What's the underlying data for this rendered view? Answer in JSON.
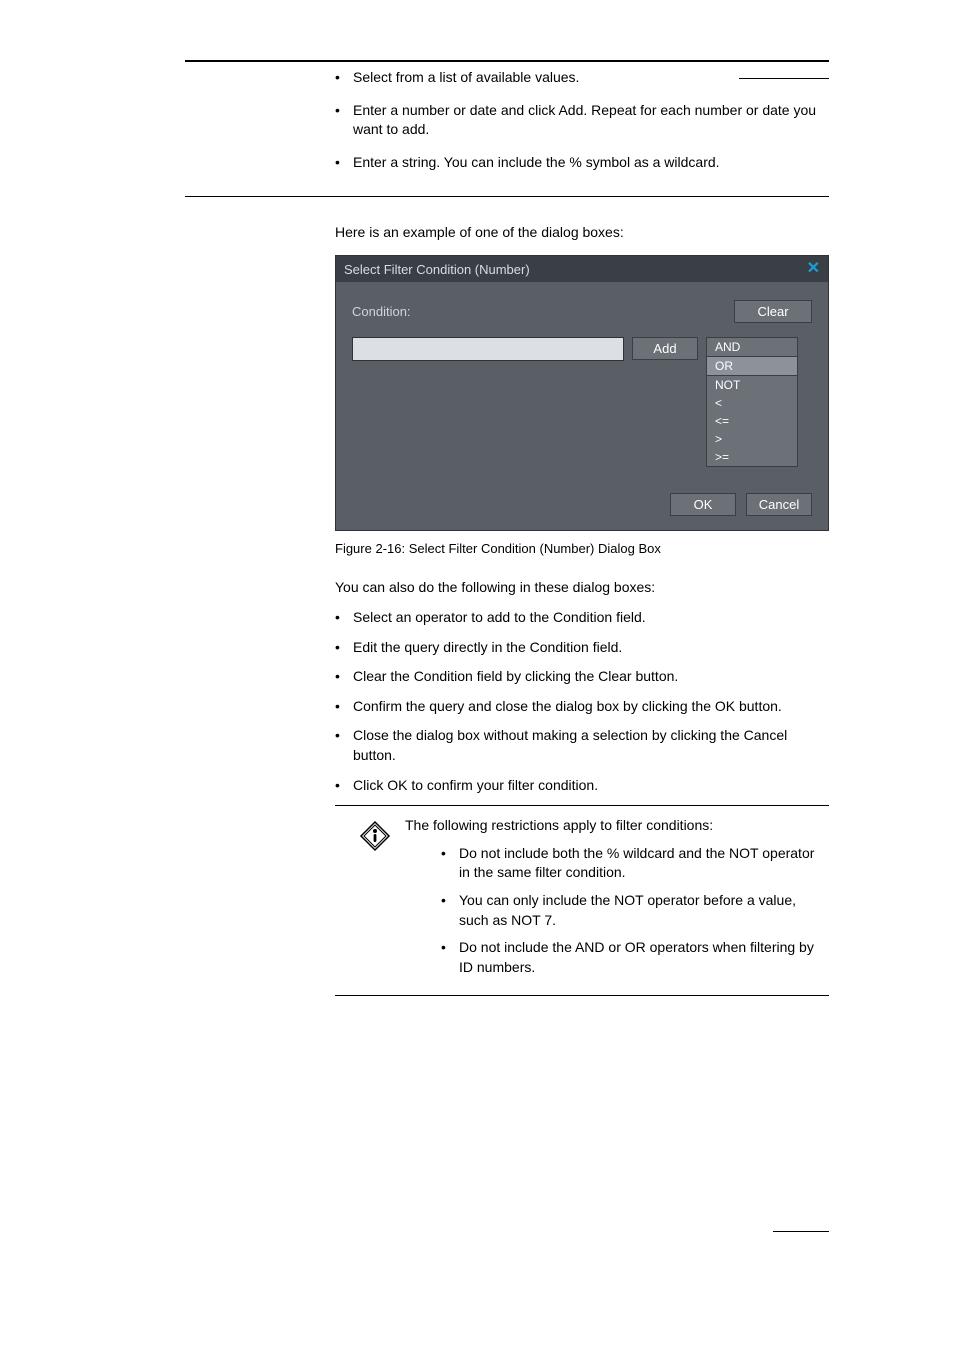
{
  "first_list": {
    "items": [
      "Select from a list of available values.",
      "Enter a number or date and click Add. Repeat for each number or date you want to add.",
      "Enter a string. You can include the % symbol as a wildcard."
    ]
  },
  "intro_text": "Here is an example of one of the dialog boxes:",
  "dialog": {
    "title": "Select Filter Condition (Number)",
    "condition_label": "Condition:",
    "clear_button": "Clear",
    "add_button": "Add",
    "ok_button": "OK",
    "cancel_button": "Cancel",
    "operators": [
      "AND",
      "OR",
      "NOT",
      "<",
      "<=",
      ">",
      ">="
    ],
    "selected_operator": "OR"
  },
  "figure_caption": "Figure 2-16: Select Filter Condition (Number) Dialog Box",
  "para_after": "You can also do the following in these dialog boxes:",
  "second_list": {
    "items": [
      "Select an operator to add to the Condition field.",
      "Edit the query directly in the Condition field.",
      "Clear the Condition field by clicking the Clear button.",
      "Confirm the query and close the dialog box by clicking the OK button.",
      "Close the dialog box without making a selection by clicking the Cancel button.",
      "Click OK to confirm your filter condition."
    ]
  },
  "note": {
    "intro": "The following restrictions apply to filter conditions:",
    "items": [
      "Do not include both the % wildcard and the NOT operator in the same filter condition.",
      "You can only include the NOT operator before a value, such as NOT 7.",
      "Do not include the AND or OR operators when filtering by ID numbers."
    ]
  }
}
